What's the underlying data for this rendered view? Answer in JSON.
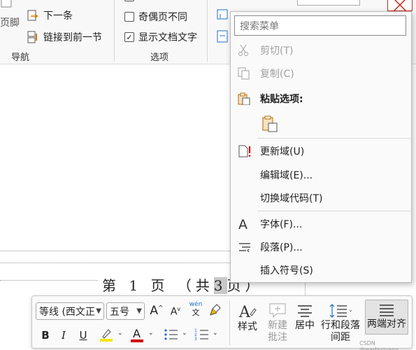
{
  "ribbon": {
    "header_footer_partial": "页脚",
    "nav_items": [
      "下一条",
      "链接到前一节"
    ],
    "nav_group_label": "导航",
    "options": [
      {
        "label": "奇偶页不同",
        "checked": false
      },
      {
        "label": "显示文档文字",
        "checked": true
      }
    ],
    "options_group_label": "选项"
  },
  "document": {
    "footer_text": "第 1 页 （共",
    "footer_selected": "3",
    "footer_after": "页）"
  },
  "context_menu": {
    "search_placeholder": "搜索菜单",
    "items": [
      {
        "label": "剪切(T)",
        "icon": "scissors-icon",
        "enabled": false
      },
      {
        "label": "复制(C)",
        "icon": "copy-icon",
        "enabled": false
      },
      {
        "label": "粘贴选项:",
        "icon": "paste-icon",
        "enabled": true,
        "bold": true
      },
      {
        "label": "更新域(U)",
        "icon": "update-field-icon",
        "enabled": true
      },
      {
        "label": "编辑域(E)...",
        "icon": "",
        "enabled": true
      },
      {
        "label": "切换域代码(T)",
        "icon": "",
        "enabled": true
      },
      {
        "label": "字体(F)...",
        "icon": "font-icon",
        "enabled": true
      },
      {
        "label": "段落(P)...",
        "icon": "paragraph-icon",
        "enabled": true
      },
      {
        "label": "插入符号(S)",
        "icon": "",
        "enabled": true
      }
    ]
  },
  "mini_toolbar": {
    "font_name": "等线 (西文正",
    "font_size": "五号",
    "phonetic_top": "wén",
    "phonetic_bottom": "文",
    "bold": "B",
    "italic": "I",
    "underline": "U",
    "font_color_letter": "A",
    "styles_label": "样式",
    "new_comment_label": [
      "新建",
      "批注"
    ],
    "center_label": "居中",
    "line_spacing_label": [
      "行和段落",
      "间距"
    ],
    "justify_label": "两端对齐",
    "highlight_color": "#f2e600",
    "font_color": "#d00000"
  },
  "watermark": "CSDN @wadaxiyang"
}
